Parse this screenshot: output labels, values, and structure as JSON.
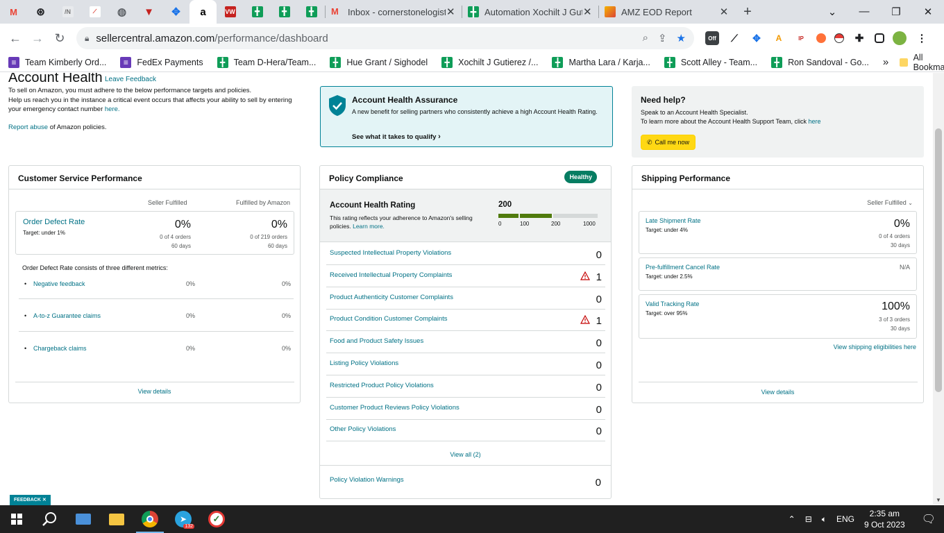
{
  "browser": {
    "tabs": [
      {
        "label": "",
        "icon": "gmail-icon"
      },
      {
        "label": "",
        "icon": "openai-icon"
      },
      {
        "label": "",
        "icon": "site-icon"
      },
      {
        "label": "",
        "icon": "site-icon"
      },
      {
        "label": "",
        "icon": "globe-icon"
      },
      {
        "label": "",
        "icon": "fedex-icon"
      },
      {
        "label": "",
        "icon": "tool-icon"
      },
      {
        "label": "",
        "icon": "amazon-icon"
      },
      {
        "label": "",
        "icon": "vw-icon"
      },
      {
        "label": "",
        "icon": "sheets-icon"
      },
      {
        "label": "",
        "icon": "sheets-icon"
      },
      {
        "label": "",
        "icon": "sheets-icon"
      },
      {
        "label": "Inbox - cornerstonelogisti",
        "icon": "gmail-icon"
      },
      {
        "label": "Automation Xochilt J Guti",
        "icon": "sheets-icon"
      },
      {
        "label": "AMZ EOD Report",
        "icon": "slides-icon"
      }
    ],
    "url_host": "sellercentral.amazon.com",
    "url_path": "/performance/dashboard",
    "bookmarks": [
      {
        "label": "Team Kimberly Ord...",
        "icon": "forms"
      },
      {
        "label": "FedEx Payments",
        "icon": "forms"
      },
      {
        "label": "Team D-Hera/Team...",
        "icon": "sheets"
      },
      {
        "label": "Hue Grant / Sighodel",
        "icon": "sheets"
      },
      {
        "label": "Xochilt J Gutierez /...",
        "icon": "sheets"
      },
      {
        "label": "Martha Lara / Karja...",
        "icon": "sheets"
      },
      {
        "label": "Scott Alley - Team...",
        "icon": "sheets"
      },
      {
        "label": "Ron Sandoval - Go...",
        "icon": "sheets"
      }
    ],
    "more_bookmarks": "»",
    "all_bookmarks": "All Bookmarks",
    "ext_off_label": "Off"
  },
  "header": {
    "title": "Account Health",
    "feedback_link": "Leave Feedback",
    "desc_line1": "To sell on Amazon, you must adhere to the below performance targets and policies.",
    "desc_line2": "Help us reach you in the instance a critical event occurs that affects your ability to sell by entering your emergency contact number",
    "desc_here": "here.",
    "report_link": "Report abuse",
    "report_rest": "of Amazon policies."
  },
  "assurance": {
    "title": "Account Health Assurance",
    "desc": "A new benefit for selling partners who consistently achieve a high Account Health Rating.",
    "qualify_link": "See what it takes to qualify"
  },
  "help": {
    "title": "Need help?",
    "line1": "Speak to an Account Health Specialist.",
    "line2": "To learn more about the Account Health Support Team, click",
    "here": "here",
    "button": "Call me now"
  },
  "customer_service": {
    "title": "Customer Service Performance",
    "col_seller": "Seller Fulfilled",
    "col_fba": "Fulfilled by Amazon",
    "odr_label": "Order Defect Rate",
    "odr_target": "Target: under 1%",
    "odr_seller_value": "0%",
    "odr_seller_orders": "0 of 4 orders",
    "odr_seller_days": "60 days",
    "odr_fba_value": "0%",
    "odr_fba_orders": "0 of 219 orders",
    "odr_fba_days": "60 days",
    "metrics_intro": "Order Defect Rate consists of three different metrics:",
    "metrics": [
      {
        "label": "Negative feedback",
        "seller": "0%",
        "fba": "0%"
      },
      {
        "label": "A-to-z Guarantee claims",
        "seller": "0%",
        "fba": "0%"
      },
      {
        "label": "Chargeback claims",
        "seller": "0%",
        "fba": "0%"
      }
    ],
    "view_details": "View details"
  },
  "policy": {
    "title": "Policy Compliance",
    "badge": "Healthy",
    "ahr_title": "Account Health Rating",
    "ahr_desc": "This rating reflects your adherence to Amazon's selling policies.",
    "learn_more": "Learn more.",
    "ahr_value": "200",
    "ahr_value_num": 200,
    "scale_ticks": [
      "0",
      "100",
      "200",
      "1000"
    ],
    "rows": [
      {
        "label": "Suspected Intellectual Property Violations",
        "value": "0",
        "warn": false
      },
      {
        "label": "Received Intellectual Property Complaints",
        "value": "1",
        "warn": true
      },
      {
        "label": "Product Authenticity Customer Complaints",
        "value": "0",
        "warn": false
      },
      {
        "label": "Product Condition Customer Complaints",
        "value": "1",
        "warn": true
      },
      {
        "label": "Food and Product Safety Issues",
        "value": "0",
        "warn": false
      },
      {
        "label": "Listing Policy Violations",
        "value": "0",
        "warn": false
      },
      {
        "label": "Restricted Product Policy Violations",
        "value": "0",
        "warn": false
      },
      {
        "label": "Customer Product Reviews Policy Violations",
        "value": "0",
        "warn": false
      },
      {
        "label": "Other Policy Violations",
        "value": "0",
        "warn": false
      }
    ],
    "view_all": "View all (2)",
    "warnings_label": "Policy Violation Warnings",
    "warnings_value": "0"
  },
  "shipping": {
    "title": "Shipping Performance",
    "filter": "Seller Fulfilled",
    "items": [
      {
        "label": "Late Shipment Rate",
        "target": "Target: under 4%",
        "value": "0%",
        "orders": "0 of 4 orders",
        "days": "30 days"
      },
      {
        "label": "Pre-fulfillment Cancel Rate",
        "target": "Target: under 2.5%",
        "value": "N/A",
        "orders": "",
        "days": ""
      },
      {
        "label": "Valid Tracking Rate",
        "target": "Target: over 95%",
        "value": "100%",
        "orders": "3 of 3 orders",
        "days": "30 days"
      }
    ],
    "eligibility_link": "View shipping eligibilities here",
    "view_details": "View details"
  },
  "feedback_tab": "FEEDBACK",
  "taskbar": {
    "telegram_badge": "132",
    "language": "ENG",
    "time": "2:35 am",
    "date": "9 Oct 2023"
  }
}
